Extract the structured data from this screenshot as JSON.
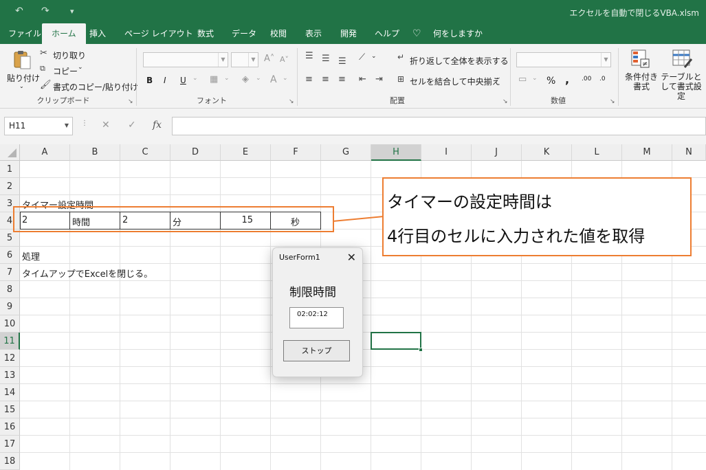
{
  "window": {
    "title": "エクセルを自動で閉じるVBA.xlsm"
  },
  "quick_access": {
    "undo": "↶",
    "redo": "↷",
    "customize": "▾"
  },
  "tabs": [
    "ファイル",
    "ホーム",
    "挿入",
    "ページ レイアウト",
    "数式",
    "データ",
    "校閲",
    "表示",
    "開発",
    "ヘルプ",
    "何をしますか"
  ],
  "ribbon": {
    "clipboard": {
      "label": "クリップボード",
      "paste": "貼り付け",
      "cut": "切り取り",
      "copy": "コピー",
      "format_painter": "書式のコピー/貼り付け"
    },
    "font": {
      "label": "フォント",
      "bold": "B",
      "italic": "I",
      "underline": "U"
    },
    "alignment": {
      "label": "配置",
      "wrap": "折り返して全体を表示する",
      "merge": "セルを結合して中央揃え"
    },
    "number": {
      "label": "数値",
      "percent": "%",
      "comma": ","
    },
    "styles": {
      "conditional": "条件付き書式",
      "table": "テーブルとして書式設定"
    }
  },
  "formula_bar": {
    "name_box": "H11",
    "cancel": "✕",
    "enter": "✓",
    "fx": "fx",
    "value": ""
  },
  "columns": [
    "A",
    "B",
    "C",
    "D",
    "E",
    "F",
    "G",
    "H",
    "I",
    "J",
    "K",
    "L",
    "M",
    "N"
  ],
  "rows": [
    "1",
    "2",
    "3",
    "4",
    "5",
    "6",
    "7",
    "8",
    "9",
    "10",
    "11",
    "12",
    "13",
    "14",
    "15",
    "16",
    "17",
    "18"
  ],
  "cells": {
    "A3": "タイマー設定時間",
    "A4": "2",
    "B4": "時間",
    "C4": "2",
    "D4": "分",
    "E4": "15",
    "F4": "秒",
    "A6": "処理",
    "A7": "タイムアップでExcelを閉じる。"
  },
  "selected_cell": "H11",
  "callout": {
    "line1": "タイマーの設定時間は",
    "line2": "4行目のセルに入力された値を取得"
  },
  "userform": {
    "title": "UserForm1",
    "label": "制限時間",
    "time": "02:02:12",
    "button": "ストップ"
  },
  "colors": {
    "excel_green": "#217346",
    "callout_orange": "#ed7d31"
  }
}
